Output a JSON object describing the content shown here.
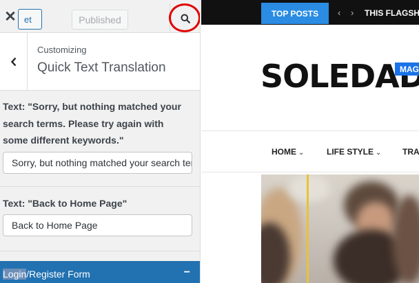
{
  "customizer": {
    "close_label": "✕",
    "save_label": "et",
    "published_label": "Published",
    "section_subtitle": "Customizing",
    "section_title": "Quick Text Translation",
    "fields": [
      {
        "label": "Text: \"Sorry, but nothing matched your search terms. Please try again with some different keywords.\"",
        "label_lines": [
          "Text: \"Sorry, but nothing matched your",
          "search terms. Please try again with",
          "some different keywords.\""
        ],
        "value": "Sorry, but nothing matched your search terms. Please try again with some different keywords."
      },
      {
        "label": "Text: \"Back to Home Page\"",
        "label_lines": [
          "Text: \"Back to Home Page\""
        ],
        "value": "Back to Home Page"
      }
    ],
    "form_section": {
      "label_highlight": "Login",
      "label_rest": "/Register Form",
      "toggle": "−"
    },
    "icons": [
      "close-icon",
      "search-icon",
      "chevron-left-icon"
    ],
    "colors": {
      "accent": "#2271b1",
      "highlight_circle": "#e00000"
    }
  },
  "preview": {
    "ticker": {
      "badge": "TOP POSTS",
      "prev": "‹",
      "next": "›",
      "headline": "THIS FLAGSH"
    },
    "logo": {
      "text": "SOLEDAD",
      "badge": "MAG"
    },
    "nav": [
      {
        "label": "HOME",
        "chevron": "⌄"
      },
      {
        "label": "LIFE STYLE",
        "chevron": "⌄"
      },
      {
        "label": "TRA",
        "chevron": ""
      }
    ],
    "colors": {
      "ticker_bg": "#111111",
      "badge_bg": "#2a8ce3",
      "logo_badge_bg": "#1a73e8"
    }
  }
}
